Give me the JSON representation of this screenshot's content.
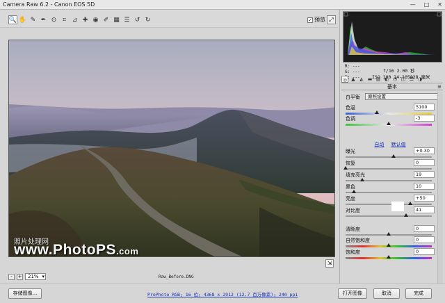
{
  "window": {
    "title": "Camera Raw 6.2 -  Canon EOS 5D",
    "controls": [
      "—",
      "□",
      "✕"
    ]
  },
  "toolbar": {
    "tools": [
      {
        "icon": "zoom-icon",
        "glyph": "🔍"
      },
      {
        "icon": "hand-icon",
        "glyph": "✋"
      },
      {
        "icon": "white-balance-icon",
        "glyph": "✎"
      },
      {
        "icon": "color-sampler-icon",
        "glyph": "✒"
      },
      {
        "icon": "target-adjust-icon",
        "glyph": "⊙"
      },
      {
        "icon": "crop-icon",
        "glyph": "⌗"
      },
      {
        "icon": "straighten-icon",
        "glyph": "⊿"
      },
      {
        "icon": "spot-removal-icon",
        "glyph": "✚"
      },
      {
        "icon": "red-eye-icon",
        "glyph": "◉"
      },
      {
        "icon": "adjustment-brush-icon",
        "glyph": "✐"
      },
      {
        "icon": "graduated-filter-icon",
        "glyph": "▦"
      },
      {
        "icon": "preferences-icon",
        "glyph": "☰"
      },
      {
        "icon": "rotate-ccw-icon",
        "glyph": "↺"
      },
      {
        "icon": "rotate-cw-icon",
        "glyph": "↻"
      }
    ],
    "preview_label": "预览",
    "preview_checked": "✓",
    "fullscreen_glyph": "⤢"
  },
  "watermark": {
    "small": "照片处理网",
    "big": "www.PhotoPS",
    "suffix": ".com"
  },
  "corner_glyph": "⇲",
  "zoom": {
    "minus": "-",
    "plus": "+",
    "level": "21%"
  },
  "filename": "Raw_Before.DNG",
  "bottom": {
    "save_label": "存储图像...",
    "workflow": "ProPhoto RGB; 16 位; 4368 x 2912 (12.7 百万像素); 240 ppi",
    "open_label": "打开图像",
    "cancel_label": "取消",
    "done_label": "完成"
  },
  "info": {
    "r": "R:  ---",
    "g": "G:  ---",
    "b": "B:  ---",
    "aperture": "f/16  2.00 秒",
    "iso": "ISO 100  24-105@28 毫米"
  },
  "panel": {
    "section_title": "基本",
    "section_menu_glyph": "≡",
    "tab_glyphs": [
      "◎",
      "▲",
      "◭",
      "▬",
      "▥",
      "◐",
      "◔",
      "◫",
      "☰",
      "◑"
    ],
    "wb_label": "白平衡",
    "wb_value": "原照设置",
    "auto_label": "自动",
    "default_label": "默认值",
    "adjustments": [
      {
        "label": "色温",
        "value": "5100",
        "pos": 0.36,
        "track": "temp"
      },
      {
        "label": "色调",
        "value": "-3",
        "pos": 0.5,
        "track": "tint"
      },
      {
        "label": "曝光",
        "value": "+0.30",
        "pos": 0.56,
        "track": ""
      },
      {
        "label": "恢复",
        "value": "0",
        "pos": 0.0,
        "track": ""
      },
      {
        "label": "填充亮光",
        "value": "19",
        "pos": 0.19,
        "track": ""
      },
      {
        "label": "黑色",
        "value": "10",
        "pos": 0.1,
        "track": ""
      },
      {
        "label": "亮度",
        "value": "+50",
        "pos": 0.75,
        "track": ""
      },
      {
        "label": "对比度",
        "value": "41",
        "pos": 0.7,
        "track": ""
      },
      {
        "label": "清晰度",
        "value": "0",
        "pos": 0.5,
        "track": ""
      },
      {
        "label": "自然饱和度",
        "value": "0",
        "pos": 0.5,
        "track": "vib"
      },
      {
        "label": "饱和度",
        "value": "0",
        "pos": 0.5,
        "track": "vib"
      }
    ]
  }
}
